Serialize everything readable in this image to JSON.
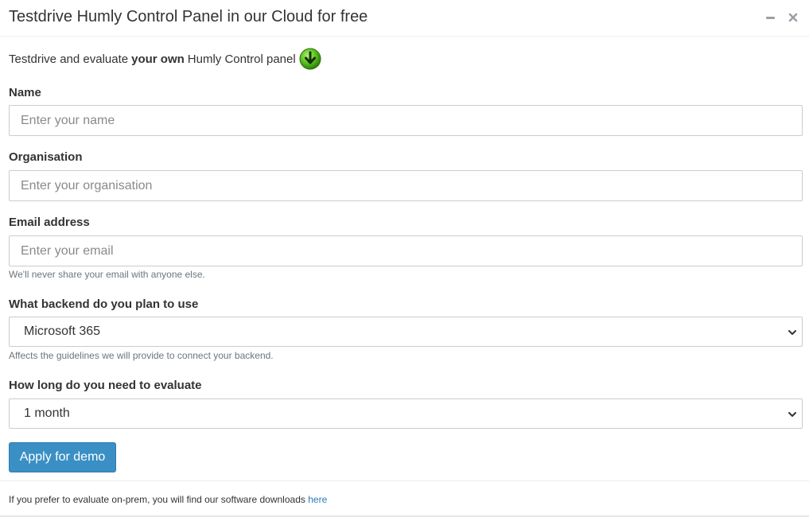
{
  "dialog": {
    "title": "Testdrive Humly Control Panel in our Cloud for free",
    "minimize_icon": "minimize-icon",
    "close_icon": "close-icon"
  },
  "intro": {
    "prefix": "Testdrive and evaluate",
    "emphasis": "your own",
    "suffix": "Humly Control panel",
    "icon": "green-arrow-down-icon",
    "icon_color": "#4caf1a"
  },
  "form": {
    "name": {
      "label": "Name",
      "placeholder": "Enter your name",
      "value": ""
    },
    "organisation": {
      "label": "Organisation",
      "placeholder": "Enter your organisation",
      "value": ""
    },
    "email": {
      "label": "Email address",
      "placeholder": "Enter your email",
      "value": "",
      "help": "We'll never share your email with anyone else."
    },
    "backend": {
      "label": "What backend do you plan to use",
      "selected": "Microsoft 365",
      "help": "Affects the guidelines we will provide to connect your backend."
    },
    "duration": {
      "label": "How long do you need to evaluate",
      "selected": "1 month"
    },
    "submit_label": "Apply for demo"
  },
  "footer": {
    "text": "If you prefer to evaluate on-prem, you will find our software downloads",
    "link_text": "here"
  },
  "colors": {
    "primary_button": "#3a8fc4",
    "link": "#2a7bb6"
  }
}
